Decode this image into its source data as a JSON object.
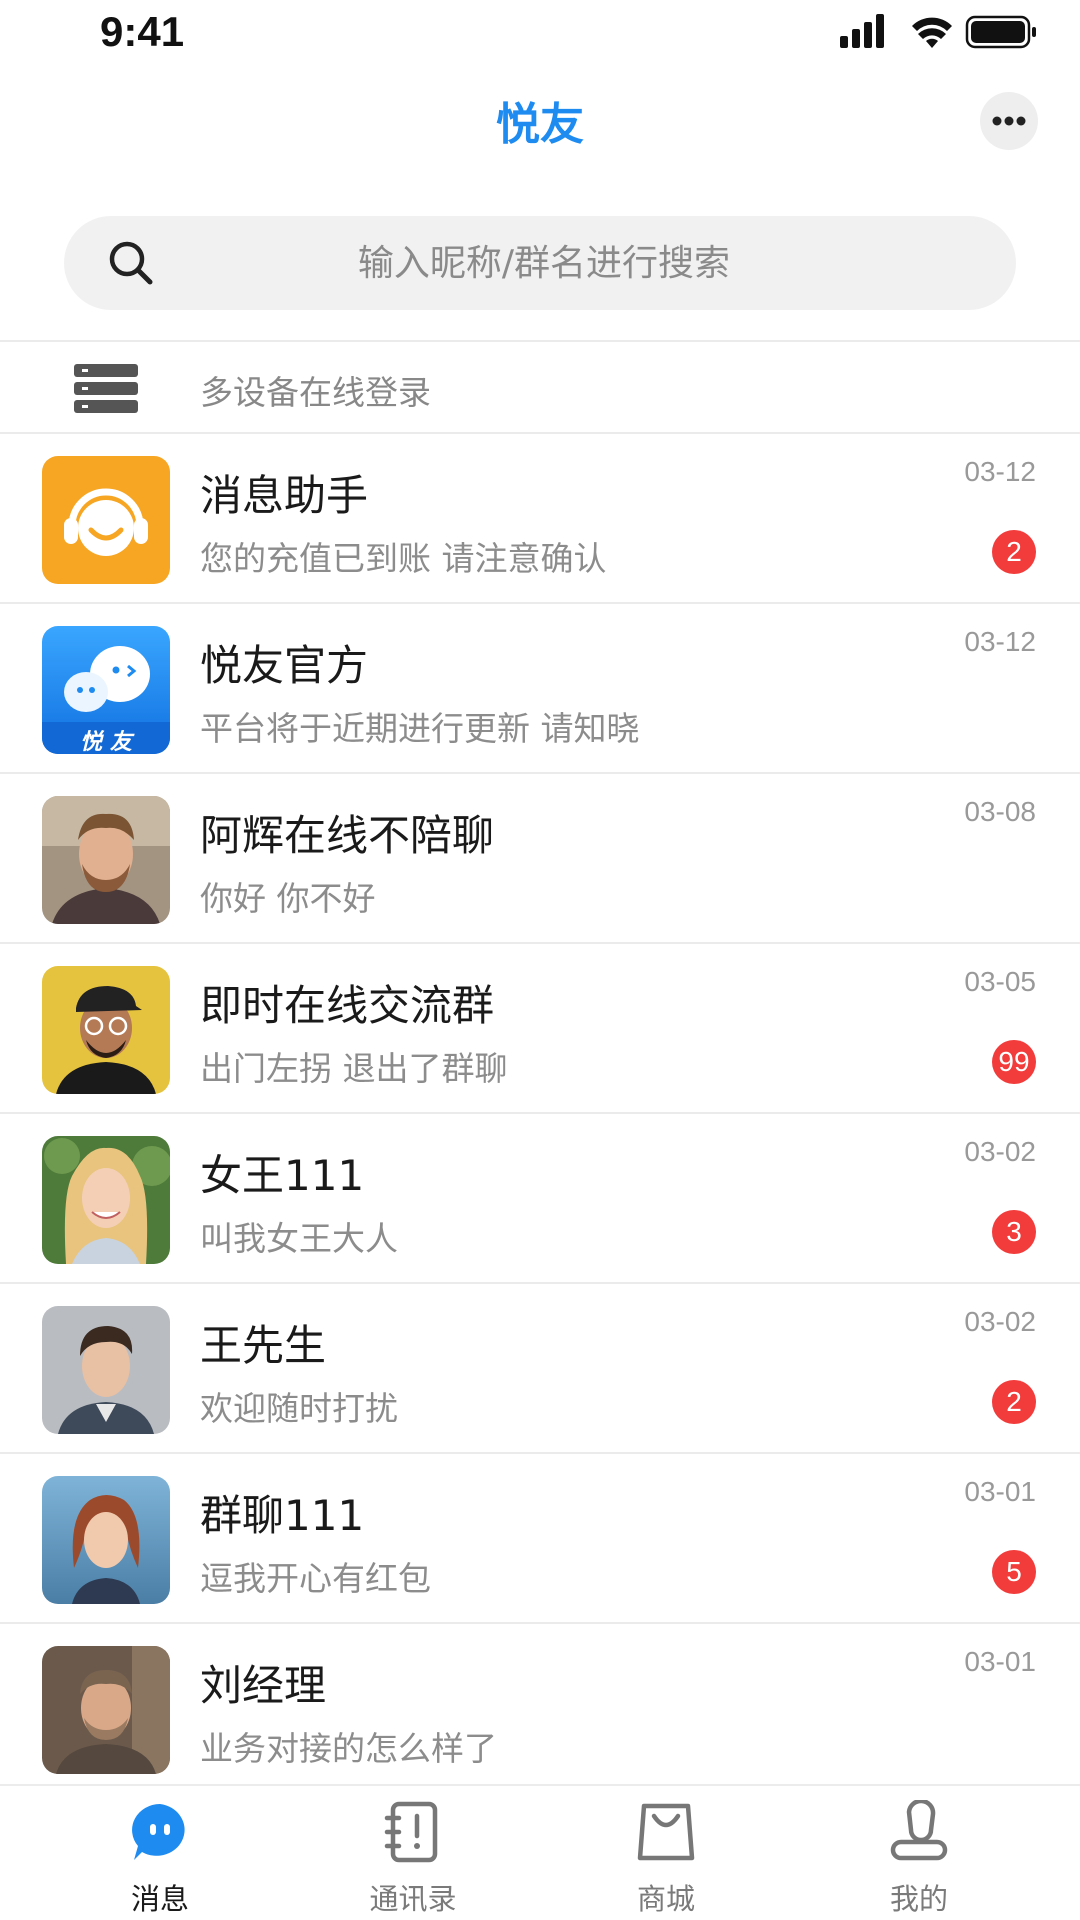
{
  "status_bar": {
    "time": "9:41"
  },
  "header": {
    "title": "悦友"
  },
  "search": {
    "placeholder": "输入昵称/群名进行搜索"
  },
  "device_row": {
    "label": "多设备在线登录"
  },
  "chats": [
    {
      "name": "消息助手",
      "preview": "您的充值已到账 请注意确认",
      "time": "03-12",
      "badge": "2",
      "avatar": "assistant-headset-avatar"
    },
    {
      "name": "悦友官方",
      "preview": "平台将于近期进行更新 请知晓",
      "time": "03-12",
      "badge": "",
      "avatar": "official-logo-avatar",
      "avatar_text": "悦 友"
    },
    {
      "name": "阿辉在线不陪聊",
      "preview": "你好  你不好",
      "time": "03-08",
      "badge": "",
      "avatar": "man-beard-photo"
    },
    {
      "name": "即时在线交流群",
      "preview": "出门左拐 退出了群聊",
      "time": "03-05",
      "badge": "99",
      "avatar": "man-cap-photo"
    },
    {
      "name": "女王111",
      "preview": "叫我女王大人",
      "time": "03-02",
      "badge": "3",
      "avatar": "woman-blonde-photo"
    },
    {
      "name": "王先生",
      "preview": "欢迎随时打扰",
      "time": "03-02",
      "badge": "2",
      "avatar": "man-young-photo"
    },
    {
      "name": "群聊111",
      "preview": "逗我开心有红包",
      "time": "03-01",
      "badge": "5",
      "avatar": "woman-redhead-photo"
    },
    {
      "name": "刘经理",
      "preview": "业务对接的怎么样了",
      "time": "03-01",
      "badge": "",
      "avatar": "man-shortbeard-photo"
    }
  ],
  "tabs": [
    {
      "label": "消息",
      "icon": "chat-bubble-icon",
      "active": true
    },
    {
      "label": "通讯录",
      "icon": "contacts-book-icon",
      "active": false
    },
    {
      "label": "商城",
      "icon": "shopping-bag-icon",
      "active": false
    },
    {
      "label": "我的",
      "icon": "user-profile-icon",
      "active": false
    }
  ],
  "colors": {
    "accent": "#1e8bf0",
    "badge": "#f23b3b",
    "assistant_bg": "#f6a623"
  }
}
